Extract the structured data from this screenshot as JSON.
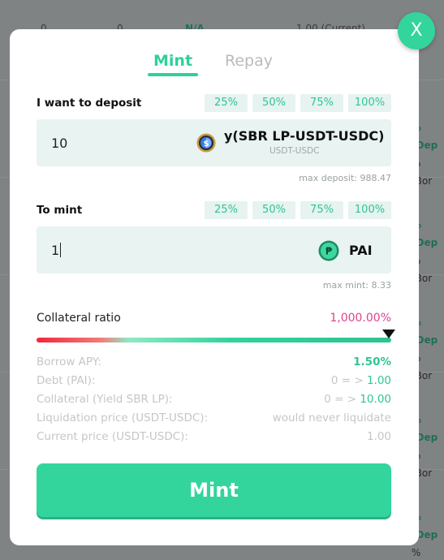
{
  "background": {
    "top_row": [
      "0",
      "0",
      "N/A",
      "1.00 (Current)"
    ],
    "right_rows": [
      {
        "label": "% (Dep",
        "sub": "% (Bor"
      },
      {
        "label": "% (Dep",
        "sub": "% (Bor"
      },
      {
        "label": "% (Dep",
        "sub": "% (Bor"
      },
      {
        "label": "% (Dep",
        "sub": "% (Bor"
      },
      {
        "label": "% (Dep",
        "sub": "% (Bor"
      }
    ]
  },
  "modal": {
    "close_label": "X",
    "tabs": [
      {
        "label": "Mint",
        "active": true
      },
      {
        "label": "Repay",
        "active": false
      }
    ],
    "deposit": {
      "label": "I want to deposit",
      "percent_buttons": [
        "25%",
        "50%",
        "75%",
        "100%"
      ],
      "value": "10",
      "token_name": "y(SBR LP-USDT-USDC)",
      "token_sub": "USDT-USDC",
      "token_icon": "saber-lp-icon",
      "max_hint": "max deposit: 988.47"
    },
    "mint": {
      "label": "To mint",
      "percent_buttons": [
        "25%",
        "50%",
        "75%",
        "100%"
      ],
      "value": "1",
      "token_name": "PAI",
      "token_icon": "pai-coin-icon",
      "max_hint": "max mint: 8.33"
    },
    "collateral_ratio": {
      "label": "Collateral ratio",
      "value": "1,000.00%",
      "marker_level": 1.0
    },
    "stats": {
      "borrow_apy": {
        "label": "Borrow APY:",
        "value": "1.50%"
      },
      "debt": {
        "label": "Debt (PAI):",
        "from": "0",
        "arrow": "= >",
        "to": "1.00"
      },
      "collateral": {
        "label": "Collateral (Yield SBR LP):",
        "from": "0",
        "arrow": "= >",
        "to": "10.00"
      },
      "liquidation": {
        "label": "Liquidation price (USDT-USDC):",
        "value": "would never liquidate"
      },
      "current_price": {
        "label": "Current price (USDT-USDC):",
        "value": "1.00"
      }
    },
    "submit_label": "Mint"
  },
  "colors": {
    "accent": "#33d59d",
    "ratio_text": "#e0418e",
    "field_bg": "#e8f3f2"
  }
}
